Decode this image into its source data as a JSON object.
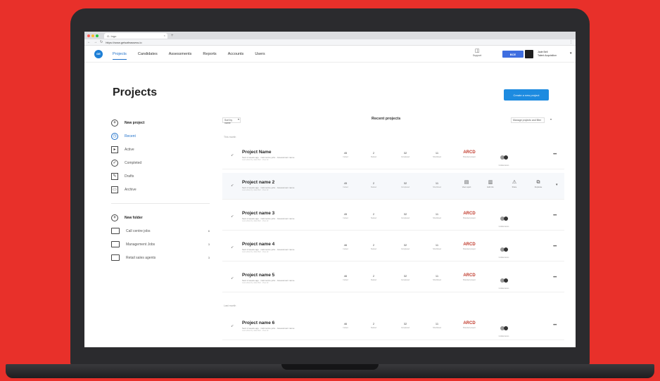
{
  "browser": {
    "tab_title": "G- Ingo",
    "url": "https://www.getsafeassess.io",
    "colors": {
      "close": "#ff5f57",
      "min": "#febc2e",
      "max": "#28c840"
    }
  },
  "nav": {
    "logo": "GE",
    "links": [
      "Projects",
      "Candidates",
      "Assessments",
      "Reports",
      "Accounts",
      "Users"
    ],
    "support_label": "Support",
    "brand_badge": "BCE",
    "user_name": "Jade Bell",
    "user_role": "Talent Acquisition"
  },
  "page": {
    "title": "Projects",
    "create_button": "Create a new project"
  },
  "sidebar": {
    "primary": [
      {
        "label": "New project",
        "icon": "plus-circle-icon"
      },
      {
        "label": "Recent",
        "icon": "clock-icon"
      },
      {
        "label": "Active",
        "icon": "play-square-icon"
      },
      {
        "label": "Completed",
        "icon": "check-circle-icon"
      },
      {
        "label": "Drafts",
        "icon": "edit-icon"
      },
      {
        "label": "Archive",
        "icon": "archive-icon"
      }
    ],
    "folder_new": "New folder",
    "folders": [
      {
        "label": "Call centre jobs",
        "count": "6"
      },
      {
        "label": "Management Jobs",
        "count": "3"
      },
      {
        "label": "Retail sales agents",
        "count": "3"
      }
    ]
  },
  "list": {
    "sort_label": "Sort by name",
    "title": "Recent projects",
    "filter_label": "Manage projects and filter",
    "section_this_month": "This month",
    "section_last_month": "Last month",
    "stat_labels": [
      "Invited",
      "Started",
      "Completed",
      "Shortlisted"
    ],
    "brand_label": "Branded project",
    "avatar_label": "Collaborators",
    "brand_mark": "ARCD",
    "actions": [
      "View report",
      "Edit info",
      "Share",
      "Duplicate"
    ],
    "projects": [
      {
        "name": "Project Name",
        "meta": "Sent 2 weeks ago · Call centre jobs · Assessment name",
        "sub": "Last edited by Jade Bell · View all",
        "stats": [
          "45",
          "2",
          "32",
          "11"
        ]
      },
      {
        "name": "Project name 2",
        "meta": "Sent 2 weeks ago · Call centre jobs · Assessment name",
        "sub": "Last edited by Jade Bell · View all",
        "stats": [
          "45",
          "2",
          "32",
          "11"
        ]
      },
      {
        "name": "Project name 3",
        "meta": "Sent 2 weeks ago · Call centre jobs · Assessment name",
        "sub": "Last edited by Jade Bell · View all",
        "stats": [
          "45",
          "2",
          "32",
          "11"
        ]
      },
      {
        "name": "Project name 4",
        "meta": "Sent 2 weeks ago · Call centre jobs · Assessment name",
        "sub": "Last edited by Jade Bell · View all",
        "stats": [
          "46",
          "2",
          "32",
          "11"
        ]
      },
      {
        "name": "Project name 5",
        "meta": "Sent 2 weeks ago · Call centre jobs · Assessment name",
        "sub": "Last edited by Jade Bell · View all",
        "stats": [
          "46",
          "2",
          "32",
          "11"
        ]
      },
      {
        "name": "Project name 6",
        "meta": "Sent 2 weeks ago · Call centre jobs · Assessment name",
        "sub": "Last edited by Jade Bell · View all",
        "stats": [
          "46",
          "2",
          "32",
          "11"
        ]
      }
    ]
  }
}
